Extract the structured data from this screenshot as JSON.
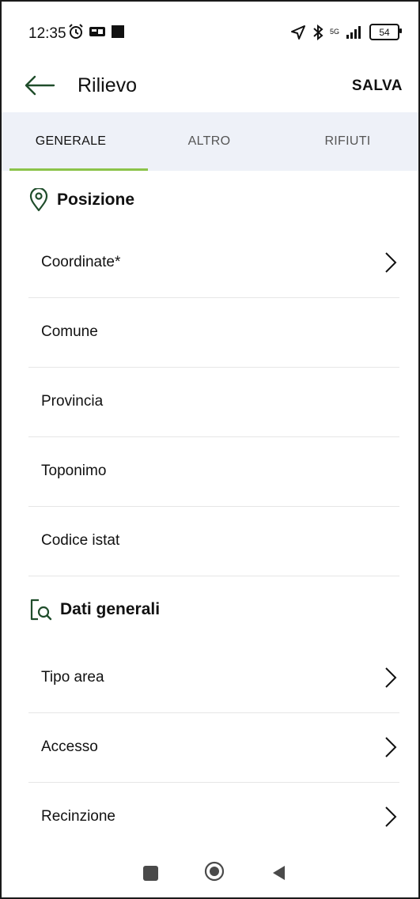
{
  "status": {
    "time": "12:35",
    "network": "5G",
    "battery": "54"
  },
  "appbar": {
    "title": "Rilievo",
    "save_label": "SALVA"
  },
  "tabs": [
    {
      "label": "GENERALE",
      "active": true
    },
    {
      "label": "ALTRO",
      "active": false
    },
    {
      "label": "RIFIUTI",
      "active": false
    }
  ],
  "sections": {
    "position": {
      "title": "Posizione",
      "rows": [
        {
          "label": "Coordinate*",
          "has_chevron": true
        },
        {
          "label": "Comune",
          "has_chevron": false
        },
        {
          "label": "Provincia",
          "has_chevron": false
        },
        {
          "label": "Toponimo",
          "has_chevron": false
        },
        {
          "label": "Codice istat",
          "has_chevron": false
        }
      ]
    },
    "general": {
      "title": "Dati generali",
      "rows": [
        {
          "label": "Tipo area",
          "has_chevron": true
        },
        {
          "label": "Accesso",
          "has_chevron": true
        },
        {
          "label": "Recinzione",
          "has_chevron": true
        }
      ]
    }
  },
  "colors": {
    "accent": "#8bc34a",
    "tab_bg": "#eef1f8",
    "icon_green": "#1f4d2b"
  }
}
